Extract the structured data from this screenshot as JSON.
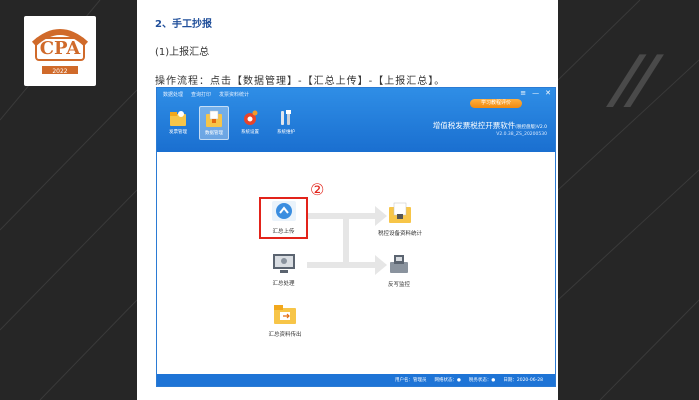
{
  "logo": {
    "text": "CPA",
    "year": "2022",
    "icon": "cpa-badge-icon"
  },
  "document": {
    "heading": "2、手工抄报",
    "sub": "(1)上报汇总",
    "steps": "操作流程：点击【数据管理】-【汇总上传】-【上报汇总】。"
  },
  "app": {
    "menu": [
      "数据处理",
      "查询打印",
      "发票资料统计"
    ],
    "learn_button": "学习教程评价",
    "window_controls": [
      "≡",
      "—",
      "✕"
    ],
    "tools": [
      {
        "label": "发票管理",
        "icon": "invoice-folder-icon",
        "active": false
      },
      {
        "label": "数据管理",
        "icon": "data-folder-icon",
        "active": true
      },
      {
        "label": "系统设置",
        "icon": "gear-icon",
        "active": false
      },
      {
        "label": "系统维护",
        "icon": "wrench-icon",
        "active": false
      }
    ],
    "product_name": "增值税发票税控开票软件",
    "product_edition": "(税控盘版)V2.0",
    "version": "V2.0.38_ZS_20200530",
    "annotation_number": "②",
    "nodes": {
      "summary_upload": "汇总上传",
      "summary_process": "汇总处理",
      "summary_export": "汇总资料传出",
      "device_stats": "税控设备资料统计",
      "anti_counterfeit": "反写监控"
    },
    "status": [
      "用户名：管理员",
      "网络状态：●",
      "税务状态：●",
      "日期：2020-06-28"
    ],
    "accent": "#1e74d6",
    "highlight": "#e2231a"
  }
}
